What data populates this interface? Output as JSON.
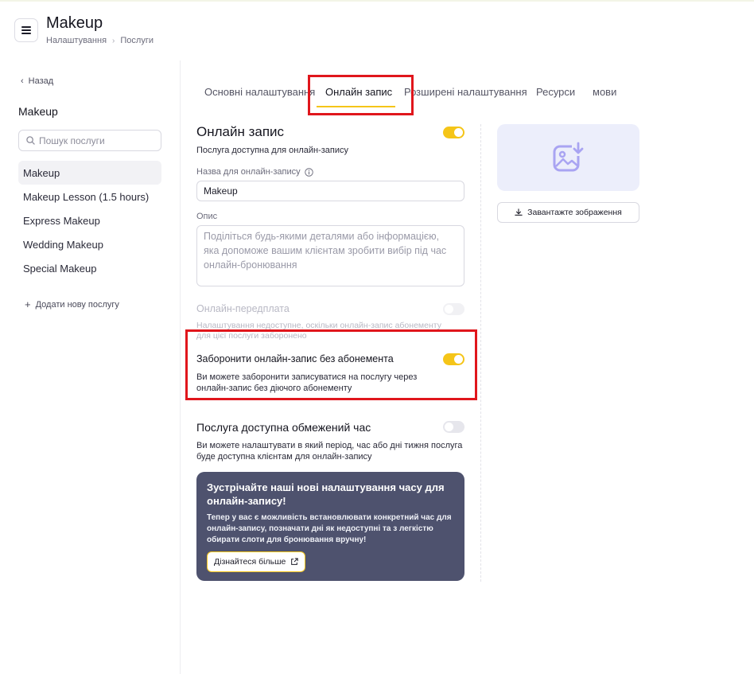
{
  "header": {
    "title": "Makeup",
    "breadcrumb": [
      "Налаштування",
      "Послуги"
    ]
  },
  "sidebar": {
    "back_label": "Назад",
    "title": "Makeup",
    "search_placeholder": "Пошук послуги",
    "services": [
      {
        "label": "Makeup",
        "active": true
      },
      {
        "label": "Makeup Lesson (1.5 hours)",
        "active": false
      },
      {
        "label": "Express Makeup",
        "active": false
      },
      {
        "label": "Wedding Makeup",
        "active": false
      },
      {
        "label": "Special Makeup",
        "active": false
      }
    ],
    "add_service_label": "Додати нову послугу"
  },
  "tabs": [
    {
      "label": "Основні налаштування",
      "active": false
    },
    {
      "label": "Онлайн запис",
      "active": true
    },
    {
      "label": "Розширені налаштування",
      "active": false
    },
    {
      "label": "Ресурси",
      "active": false
    },
    {
      "label": "мови",
      "active": false
    }
  ],
  "online_booking": {
    "title": "Онлайн запис",
    "enabled": true,
    "subtitle": "Послуга доступна для онлайн-запису",
    "name_label": "Назва для онлайн-запису",
    "name_value": "Makeup",
    "description_label": "Опис",
    "description_placeholder": "Поділіться будь-якими деталями або інформацією, яка допоможе вашим клієнтам зробити вибір під час онлайн-бронювання"
  },
  "prepayment": {
    "title": "Онлайн-передплата",
    "enabled": false,
    "note": "Налаштування недоступне, оскільки онлайн-запис абонементу для цієї послуги заборонено"
  },
  "forbid_without_subscription": {
    "title": "Заборонити онлайн-запис без абонемента",
    "enabled": true,
    "description": "Ви можете заборонити записуватися на послугу через онлайн-запис без діючого абонементу"
  },
  "limited_time": {
    "title": "Послуга доступна обмежений час",
    "enabled": false,
    "description": "Ви можете налаштувати в який період, час або дні тижня послуга буде доступна клієнтам для онлайн-запису"
  },
  "promo": {
    "title": "Зустрічайте наші нові налаштування часу для онлайн-запису!",
    "text": "Тепер у вас є можливість встановлювати конкретний час для онлайн-запису, позначати дні як недоступні та з легкістю обирати слоти для бронювання вручну!",
    "button_label": "Дізнайтеся більше"
  },
  "image": {
    "upload_label": "Завантажте зображення"
  },
  "colors": {
    "accent": "#f5c518",
    "highlight": "#e0161c",
    "promo_bg": "#4e526e"
  }
}
